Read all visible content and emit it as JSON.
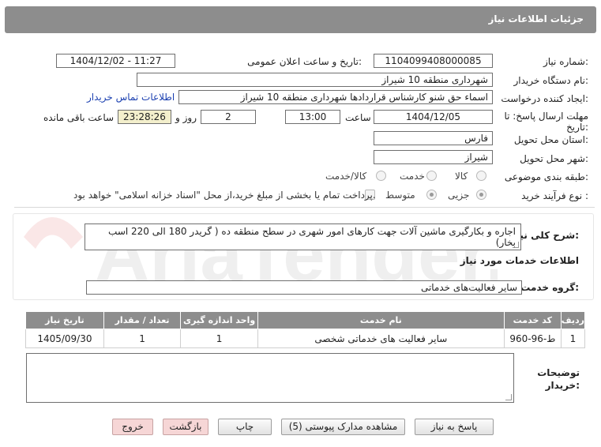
{
  "header": {
    "title": "جزئیات اطلاعات نیاز"
  },
  "fields": {
    "need_number_label": "شماره نیاز:",
    "need_number": "1104099408000085",
    "announce_label": "تاریخ و ساعت اعلان عمومی:",
    "announce_value": "1404/12/02 - 11:27",
    "buyer_org_label": "نام دستگاه خریدار:",
    "buyer_org": "شهرداری منطقه 10 شیراز",
    "creator_label": "ایجاد کننده درخواست:",
    "creator": "اسماء حق شنو کارشناس قراردادها شهرداری منطقه 10 شیراز",
    "contact_link": "اطلاعات تماس خریدار",
    "deadline_label_1": "مهلت ارسال پاسخ: تا",
    "deadline_label_2": "تاریخ:",
    "deadline_date": "1404/12/05",
    "time_label": "ساعت",
    "deadline_time": "13:00",
    "days_value": "2",
    "days_label": "روز و",
    "remaining_time": "23:28:26",
    "remaining_label": "ساعت باقی مانده",
    "province_label": "استان محل تحویل:",
    "province": "فارس",
    "city_label": "شهر محل تحویل:",
    "city": "شیراز",
    "category_label": "طبقه بندی موضوعی:",
    "category_options": [
      "کالا",
      "خدمت",
      "کالا/خدمت"
    ],
    "category_selected": "خدمت",
    "purchase_type_label": "نوع فرآیند خرید :",
    "purchase_options": [
      "جزیی",
      "متوسط"
    ],
    "purchase_selected": "جزیی",
    "payment_note": "پرداخت تمام یا بخشی از مبلغ خرید،از محل \"اسناد خزانه اسلامی\" خواهد بود."
  },
  "description": {
    "label": "شرح کلی نیاز:",
    "text": "اجاره و بکارگیری ماشین آلات جهت کارهای امور شهری در سطح منطقه ده ( گریدر 180 الی 220 اسب بخار)"
  },
  "services": {
    "section_title": "اطلاعات خدمات مورد نیاز",
    "group_label": "گروه خدمت:",
    "group_value": "سایر فعالیت‌های خدماتی"
  },
  "table": {
    "headers": [
      "ردیف",
      "کد خدمت",
      "نام خدمت",
      "واحد اندازه گیری",
      "تعداد / مقدار",
      "تاریخ نیاز"
    ],
    "rows": [
      [
        "1",
        "ط-96-960",
        "سایر فعالیت های خدماتی شخصی",
        "1",
        "1",
        "1405/09/30"
      ]
    ]
  },
  "buyer_notes": {
    "label_1": "توضیحات",
    "label_2": "خریدار:",
    "value": ""
  },
  "buttons": {
    "reply": "پاسخ به نیاز",
    "attachments": "مشاهده مدارک پیوستی (5)",
    "print": "چاپ",
    "back": "بازگشت",
    "exit": "خروج"
  },
  "watermark_text": "AriaTender.net"
}
